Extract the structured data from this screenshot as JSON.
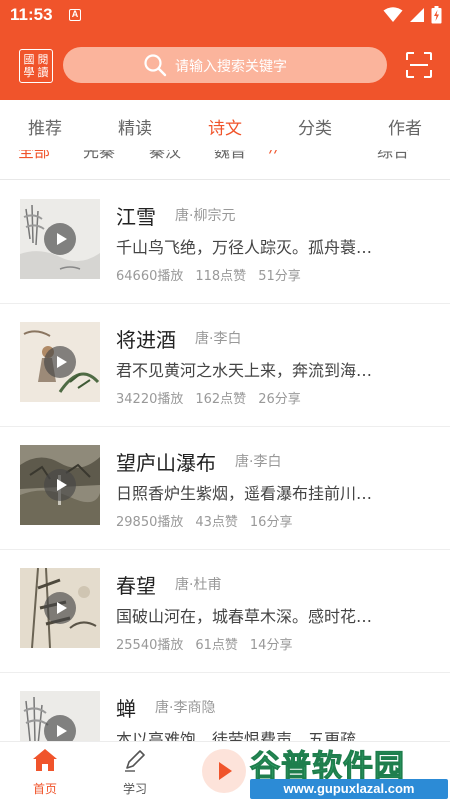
{
  "status_bar": {
    "time": "11:53",
    "badge": "A"
  },
  "header": {
    "logo_chars": [
      "閱",
      "讀",
      "國",
      "學"
    ],
    "search_placeholder": "请输入搜索关键字"
  },
  "tabs": [
    {
      "label": "推荐",
      "active": false
    },
    {
      "label": "精读",
      "active": false
    },
    {
      "label": "诗文",
      "active": true
    },
    {
      "label": "分类",
      "active": false
    },
    {
      "label": "作者",
      "active": false
    }
  ],
  "filters": {
    "chips": [
      "全部",
      "先秦",
      "秦汉",
      "魏晋"
    ],
    "more": "//",
    "sort_label": "综合"
  },
  "poems": [
    {
      "title": "江雪",
      "author": "唐·柳宗元",
      "excerpt": "千山鸟飞绝，万径人踪灭。孤舟蓑…",
      "plays": "64660播放",
      "likes": "118点赞",
      "shares": "51分享"
    },
    {
      "title": "将进酒",
      "author": "唐·李白",
      "excerpt": "君不见黄河之水天上来，奔流到海…",
      "plays": "34220播放",
      "likes": "162点赞",
      "shares": "26分享"
    },
    {
      "title": "望庐山瀑布",
      "author": "唐·李白",
      "excerpt": "日照香炉生紫烟，遥看瀑布挂前川…",
      "plays": "29850播放",
      "likes": "43点赞",
      "shares": "16分享"
    },
    {
      "title": "春望",
      "author": "唐·杜甫",
      "excerpt": "国破山河在，城春草木深。感时花…",
      "plays": "25540播放",
      "likes": "61点赞",
      "shares": "14分享"
    },
    {
      "title": "蝉",
      "author": "唐·李商隐",
      "excerpt": "本以高难饱，徒劳恨费声。五更疏…",
      "plays": "",
      "likes": "",
      "shares": ""
    }
  ],
  "bottom_nav": {
    "home": "首页",
    "study": "学习"
  },
  "watermark": {
    "text": "谷普软件园",
    "url": "www.gupuxlazal.com"
  },
  "colors": {
    "accent": "#f0542b",
    "search_bg": "#fbb49c"
  }
}
